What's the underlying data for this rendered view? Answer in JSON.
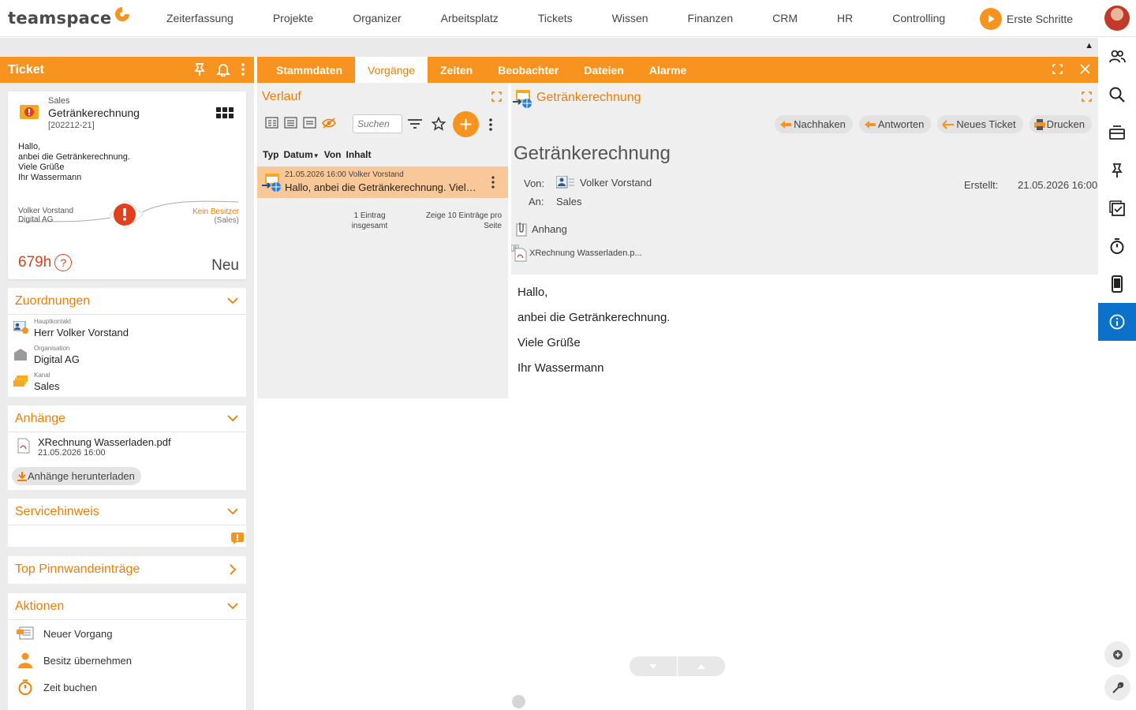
{
  "app": {
    "logo": "teamspace",
    "nav": [
      "Zeiterfassung",
      "Projekte",
      "Organizer",
      "Arbeitsplatz",
      "Tickets",
      "Wissen",
      "Finanzen",
      "CRM",
      "HR",
      "Controlling"
    ],
    "erste_schritte": "Erste Schritte"
  },
  "left": {
    "header": "Ticket",
    "ticket": {
      "category": "Sales",
      "title": "Getränkerechnung",
      "number": "[202212-21]",
      "body": [
        "Hallo,",
        "anbei die Getränkerechnung.",
        "Viele Grüße",
        "Ihr Wassermann"
      ],
      "from_name": "Volker Vorstand",
      "from_org": "Digital AG",
      "owner": "Kein Besitzer",
      "owner_group": "(Sales)",
      "hours": "679h",
      "help": "?",
      "status": "Neu"
    },
    "zuordnungen": {
      "title": "Zuordnungen",
      "rows": [
        {
          "label": "Hauptkontakt",
          "value": "Herr Volker Vorstand"
        },
        {
          "label": "Organisation",
          "value": "Digital AG"
        },
        {
          "label": "Kanal",
          "value": "Sales"
        }
      ]
    },
    "anhaenge": {
      "title": "Anhänge",
      "file": "XRechnung Wasserladen.pdf",
      "date": "21.05.2026 16:00",
      "download": "Anhänge herunterladen"
    },
    "servicehinweis": {
      "title": "Servicehinweis"
    },
    "pinnwand": {
      "title": "Top Pinnwandeinträge"
    },
    "aktionen": {
      "title": "Aktionen",
      "items": [
        "Neuer Vorgang",
        "Besitz übernehmen",
        "Zeit buchen"
      ]
    }
  },
  "tabs": [
    "Stammdaten",
    "Vorgänge",
    "Zeiten",
    "Beobachter",
    "Dateien",
    "Alarme"
  ],
  "verlauf": {
    "title": "Verlauf",
    "search_placeholder": "Suchen",
    "columns": [
      "Typ",
      "Datum",
      "Von",
      "Inhalt"
    ],
    "row": {
      "meta": "21.05.2026 16:00 Volker Vorstand",
      "text": "Hallo, anbei die Getränkerechnung. Viele Grüße Ihr Wassermann"
    },
    "footer_count": "1 Eintrag insgesamt",
    "footer_page": "Zeige  10  Einträge pro Seite"
  },
  "detail": {
    "title": "Getränkerechnung",
    "buttons": [
      "Nachhaken",
      "Antworten",
      "Neues Ticket",
      "Drucken"
    ],
    "subject": "Getränkerechnung",
    "von_label": "Von:",
    "von_value": "Volker Vorstand",
    "an_label": "An:",
    "an_value": "Sales",
    "erstellt_label": "Erstellt:",
    "erstellt_value": "21.05.2026 16:00",
    "anhang_label": "Anhang",
    "file": "XRechnung Wasserladen.p...",
    "body": [
      "Hallo,",
      "anbei die Getränkerechnung.",
      "Viele Grüße",
      "Ihr Wassermann"
    ]
  },
  "colors": {
    "accent": "#f7931e",
    "accent_text": "#f07c00",
    "rail_active": "#0a73c9",
    "alert": "#e0401c"
  }
}
